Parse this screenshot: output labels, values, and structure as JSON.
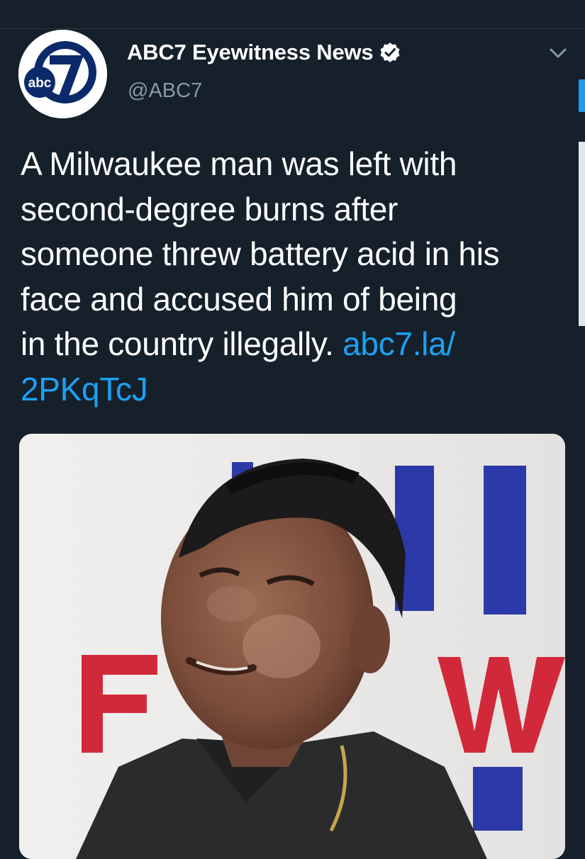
{
  "account": {
    "name": "ABC7 Eyewitness News",
    "handle": "@ABC7",
    "verified": true,
    "avatar_logo": "abc7"
  },
  "tweet": {
    "text_lines": [
      "A Milwaukee man was left with",
      "second-degree burns after",
      "someone threw battery acid in his",
      "face and accused him of being",
      "in the country illegally. "
    ],
    "link_part1": "abc7.la/",
    "link_part2": "2PKqTcJ"
  },
  "media": {
    "type": "video-still",
    "description_icon": "man-at-podium-image"
  },
  "icons": {
    "verified": "verified-badge-icon",
    "menu": "chevron-down-icon"
  },
  "colors": {
    "background": "#15202b",
    "link": "#1da1f2",
    "secondary_text": "#8899a6",
    "brand_red": "#d2293a",
    "brand_blue": "#2b3aa8"
  }
}
